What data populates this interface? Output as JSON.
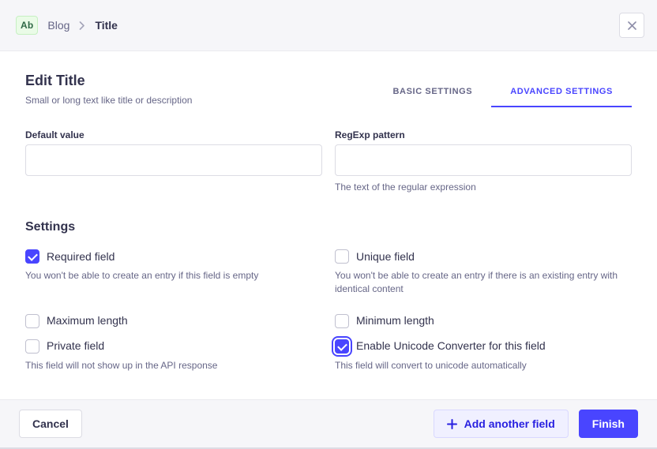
{
  "header": {
    "type_badge": "Ab",
    "breadcrumb_parent": "Blog",
    "breadcrumb_separator": "›",
    "breadcrumb_current": "Title",
    "close_icon": "close-icon"
  },
  "title_section": {
    "title": "Edit Title",
    "subtitle": "Small or long text like title or description"
  },
  "tabs": [
    {
      "label": "BASIC SETTINGS",
      "active": false
    },
    {
      "label": "ADVANCED SETTINGS",
      "active": true
    }
  ],
  "fields": {
    "default_value": {
      "label": "Default value",
      "value": "",
      "placeholder": ""
    },
    "regexp_pattern": {
      "label": "RegExp pattern",
      "value": "",
      "placeholder": "",
      "hint": "The text of the regular expression"
    }
  },
  "settings": {
    "heading": "Settings",
    "items": [
      {
        "label": "Required field",
        "hint": "You won't be able to create an entry if this field is empty",
        "checked": true,
        "focused": false
      },
      {
        "label": "Unique field",
        "hint": "You won't be able to create an entry if there is an existing entry with identical content",
        "checked": false,
        "focused": false
      },
      {
        "label": "Maximum length",
        "hint": "",
        "checked": false,
        "focused": false
      },
      {
        "label": "Minimum length",
        "hint": "",
        "checked": false,
        "focused": false
      },
      {
        "label": "Private field",
        "hint": "This field will not show up in the API response",
        "checked": false,
        "focused": false
      },
      {
        "label": "Enable Unicode Converter for this field",
        "hint": "This field will convert to unicode automatically",
        "checked": true,
        "focused": true
      }
    ]
  },
  "footer": {
    "cancel_label": "Cancel",
    "add_another_label": "Add another field",
    "add_another_icon": "plus-icon",
    "finish_label": "Finish"
  },
  "colors": {
    "accent": "#4945ff",
    "accent_dark": "#271fe0",
    "accent_light_bg": "#f0f0ff",
    "badge_bg": "#eafbe7",
    "badge_border": "#c6f0c2",
    "badge_text": "#2f6846",
    "surface": "#f6f6f9",
    "border": "#dcdce4",
    "text_primary": "#32324d",
    "text_secondary": "#666687"
  }
}
